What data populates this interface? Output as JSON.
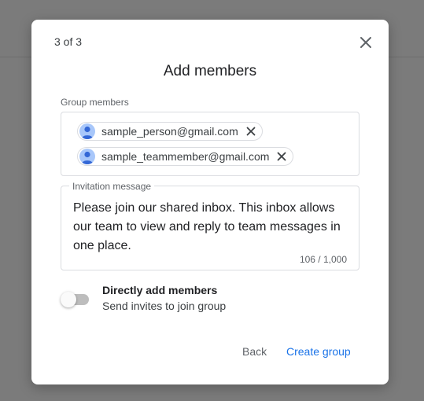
{
  "dialog": {
    "step": "3 of 3",
    "title": "Add members",
    "close_icon": "close-icon"
  },
  "members": {
    "label": "Group members",
    "chips": [
      {
        "email": "sample_person@gmail.com",
        "avatar_icon": "person-avatar-icon",
        "remove_icon": "close-icon"
      },
      {
        "email": "sample_teammember@gmail.com",
        "avatar_icon": "person-avatar-icon",
        "remove_icon": "close-icon"
      }
    ]
  },
  "invitation": {
    "label": "Invitation message",
    "text": "Please join our shared inbox. This inbox allows our team to view and reply to team messages in one place.",
    "count": "106 / 1,000"
  },
  "direct_add": {
    "title": "Directly add members",
    "subtitle": "Send invites to join group",
    "enabled": false
  },
  "actions": {
    "back_label": "Back",
    "create_label": "Create group"
  },
  "colors": {
    "accent": "#1a73e8",
    "backdrop": "#7b7b7b",
    "avatar": "#a8c7fa"
  }
}
